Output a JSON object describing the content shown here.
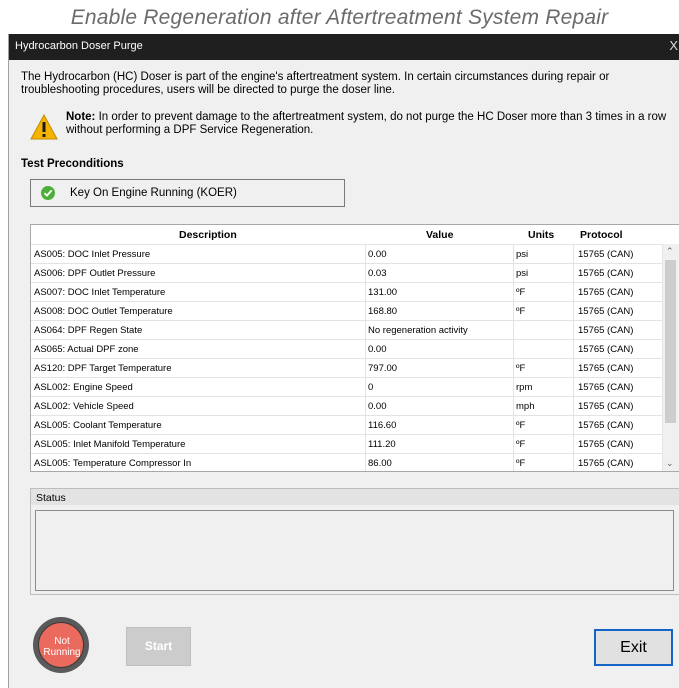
{
  "page_caption": "Enable Regeneration after Aftertreatment System Repair",
  "window": {
    "title": "Hydrocarbon Doser Purge",
    "close_glyph": "X"
  },
  "intro_text": "The Hydrocarbon (HC) Doser is part of the engine's aftertreatment system. In certain circumstances during repair or troubleshooting procedures, users will be directed to purge the doser line.",
  "note": {
    "label": "Note:",
    "text": " In order to prevent damage to the aftertreatment system, do not purge the HC Doser more than 3 times in a row without performing a DPF Service Regeneration.",
    "icon": "warning-icon"
  },
  "preconditions": {
    "heading": "Test Preconditions",
    "items": [
      {
        "label": "Key On Engine Running (KOER)",
        "status_icon": "check-icon",
        "status_color": "#4caf3a"
      }
    ]
  },
  "table": {
    "headers": [
      "Description",
      "Value",
      "Units",
      "Protocol"
    ],
    "rows": [
      [
        "AS005: DOC Inlet Pressure",
        "0.00",
        "psi",
        "15765 (CAN)"
      ],
      [
        "AS006: DPF Outlet Pressure",
        "0.03",
        "psi",
        "15765 (CAN)"
      ],
      [
        "AS007: DOC Inlet Temperature",
        "131.00",
        "ºF",
        "15765 (CAN)"
      ],
      [
        "AS008: DOC Outlet Temperature",
        "168.80",
        "ºF",
        "15765 (CAN)"
      ],
      [
        "AS064: DPF Regen State",
        "No regeneration activity",
        "",
        "15765 (CAN)"
      ],
      [
        "AS065: Actual DPF zone",
        "0.00",
        "",
        "15765 (CAN)"
      ],
      [
        "AS120: DPF Target Temperature",
        "797.00",
        "ºF",
        "15765 (CAN)"
      ],
      [
        "ASL002: Engine Speed",
        "0",
        "rpm",
        "15765 (CAN)"
      ],
      [
        "ASL002: Vehicle Speed",
        "0.00",
        "mph",
        "15765 (CAN)"
      ],
      [
        "ASL005: Coolant Temperature",
        "116.60",
        "ºF",
        "15765 (CAN)"
      ],
      [
        "ASL005: Inlet Manifold Temperature",
        "111.20",
        "ºF",
        "15765 (CAN)"
      ],
      [
        "ASL005: Temperature Compressor In",
        "86.00",
        "ºF",
        "15765 (CAN)"
      ]
    ]
  },
  "status": {
    "heading": "Status",
    "text": ""
  },
  "footer": {
    "indicator_label": "Not Running",
    "indicator_color": "#ea6a5e",
    "start_label": "Start",
    "exit_label": "Exit"
  }
}
